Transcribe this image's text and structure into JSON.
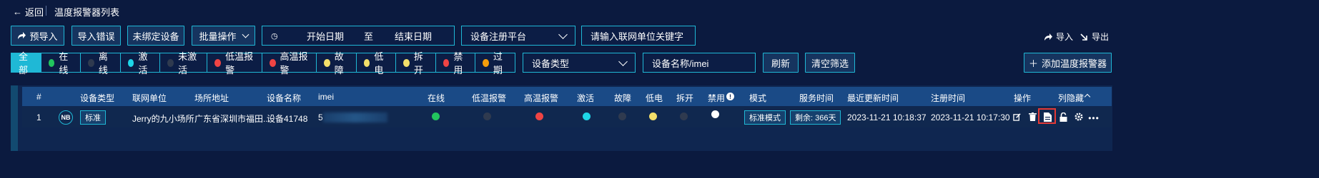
{
  "header": {
    "back_label": "返回",
    "title": "温度报警器列表"
  },
  "toolbar": {
    "pre_import": "预导入",
    "import_error": "导入错误",
    "unbound_device": "未绑定设备",
    "batch_operation": "批量操作",
    "start_date_placeholder": "开始日期",
    "date_separator": "至",
    "end_date_placeholder": "结束日期",
    "platform_select": "设备注册平台",
    "unit_keyword_placeholder": "请输入联网单位关键字",
    "import": "导入",
    "export": "导出"
  },
  "filters": {
    "items": [
      {
        "label": "全部",
        "color": null,
        "active": true
      },
      {
        "label": "在线",
        "color": "#22c55e"
      },
      {
        "label": "离线",
        "color": "#2f3a4f"
      },
      {
        "label": "激活",
        "color": "#1ed6e8"
      },
      {
        "label": "未激活",
        "color": "#2f3a4f"
      },
      {
        "label": "低温报警",
        "color": "#ef4444"
      },
      {
        "label": "高温报警",
        "color": "#ef4444"
      },
      {
        "label": "故障",
        "color": "#f3df6a"
      },
      {
        "label": "低电",
        "color": "#f3df6a"
      },
      {
        "label": "拆开",
        "color": "#f3df6a"
      },
      {
        "label": "禁用",
        "color": "#ef4444"
      },
      {
        "label": "过期",
        "color": "#f59e0b"
      }
    ],
    "device_type_select": "设备类型",
    "device_name_placeholder": "设备名称/imei",
    "refresh": "刷新",
    "clear": "清空筛选",
    "add_button": "添加温度报警器"
  },
  "table": {
    "headers": {
      "index": "#",
      "device_type": "设备类型",
      "unit": "联网单位",
      "address": "场所地址",
      "name": "设备名称",
      "imei": "imei",
      "online": "在线",
      "low_alarm": "低温报警",
      "high_alarm": "高温报警",
      "active": "激活",
      "fault": "故障",
      "low_battery": "低电",
      "opened": "拆开",
      "disabled": "禁用",
      "mode": "模式",
      "service_time": "服务时间",
      "last_update": "最近更新时间",
      "register_time": "注册时间",
      "actions": "操作",
      "hide_columns": "列隐藏"
    },
    "rows": [
      {
        "index": "1",
        "badge": "NB",
        "type_tag": "标准",
        "unit": "Jerry的九小场所",
        "address": "广东省深圳市福田...",
        "name": "设备41748",
        "imei": "5",
        "status_colors": {
          "online": "#22c55e",
          "low_alarm": "#2f3a4f",
          "high_alarm": "#ef4444",
          "active": "#1ed6e8",
          "fault": "#2f3a4f",
          "low_battery": "#f3df6a",
          "opened": "#2f3a4f",
          "disabled": "#ffffff"
        },
        "mode": "标准模式",
        "service_time": "剩余: 366天",
        "last_update": "2023-11-21 10:18:37",
        "register_time": "2023-11-21 10:17:30"
      }
    ]
  },
  "colors": {
    "accent": "#1fb8d6",
    "background": "#0b1a3f",
    "highlight": "#e53935"
  }
}
